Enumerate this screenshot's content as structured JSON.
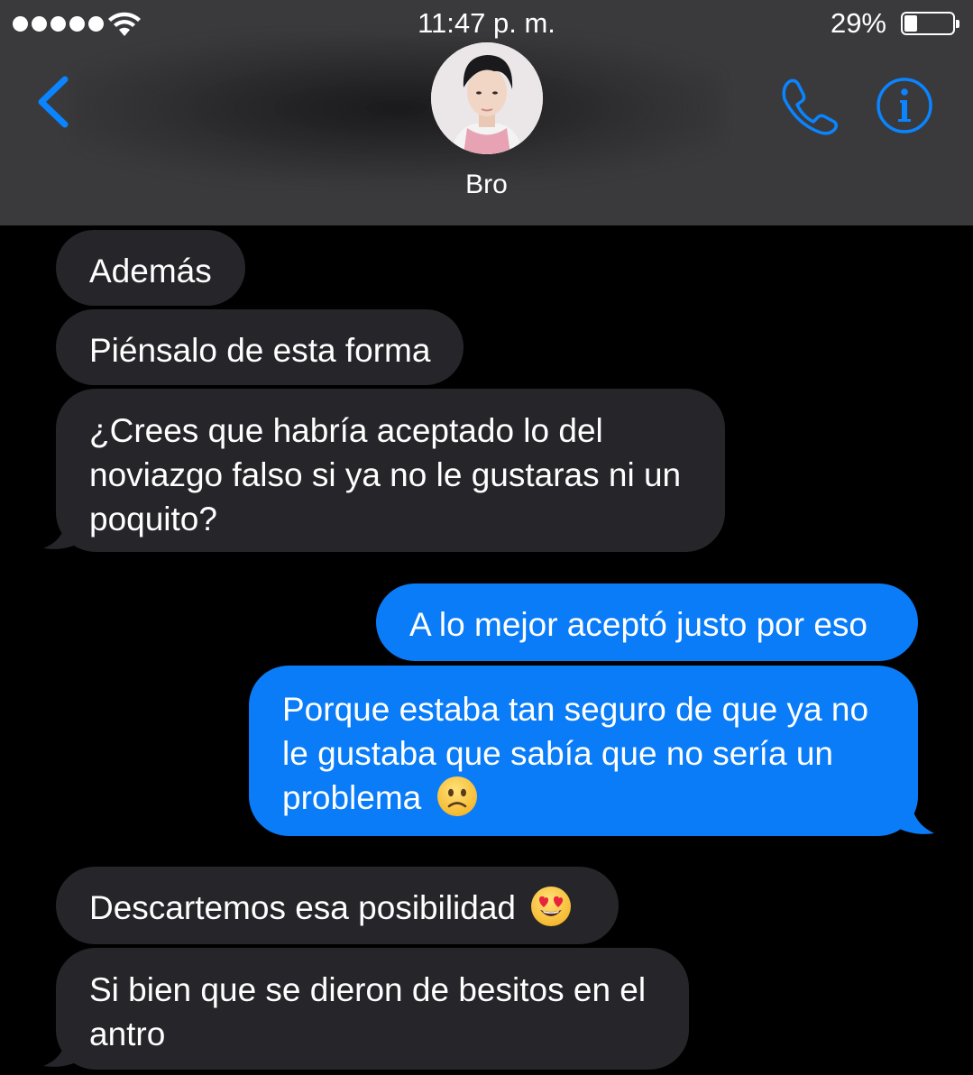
{
  "status_bar": {
    "time": "11:47 p. m.",
    "battery_percent": "29%",
    "battery_level": 0.29,
    "signal_dots": 5
  },
  "header": {
    "contact_name": "Bro",
    "back_icon": "chevron-left-icon",
    "call_icon": "phone-icon",
    "info_icon": "info-icon"
  },
  "colors": {
    "incoming_bubble": "#26252a",
    "outgoing_bubble": "#0a7cf8",
    "header_bg": "#3a3a3c",
    "accent": "#0a84ff"
  },
  "messages": [
    {
      "direction": "in",
      "text": "Además"
    },
    {
      "direction": "in",
      "text": "Piénsalo de esta forma"
    },
    {
      "direction": "in",
      "line1": "¿Crees que habría aceptado lo del",
      "line2": "noviazgo falso si ya no le gustaras ni un",
      "line3": "poquito?"
    },
    {
      "direction": "out",
      "text": "A lo mejor aceptó justo por eso"
    },
    {
      "direction": "out",
      "line1": "Porque estaba tan seguro de que ya no",
      "line2": "le gustaba que sabía que no sería un",
      "line3": "problema",
      "emoji": "slightly-frowning-face"
    },
    {
      "direction": "in",
      "text": "Descartemos esa posibilidad",
      "emoji": "heart-eyes-face"
    },
    {
      "direction": "in",
      "line1": "Si bien que se dieron de besitos en el",
      "line2": "antro"
    }
  ]
}
